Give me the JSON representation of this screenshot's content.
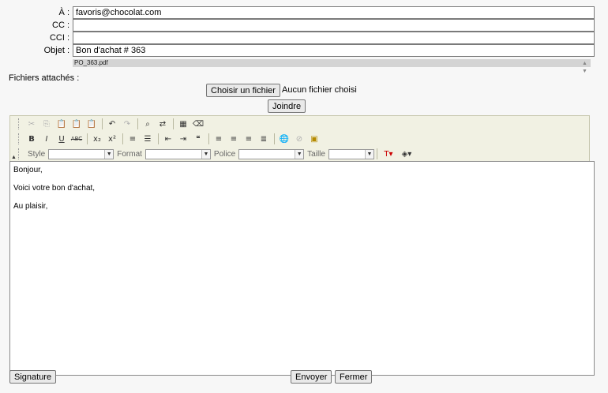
{
  "form": {
    "to_label": "À :",
    "to_value": "favoris@chocolat.com",
    "cc_label": "CC :",
    "cc_value": "",
    "bcc_label": "CCI :",
    "bcc_value": "",
    "subject_label": "Objet :",
    "subject_value": "Bon d'achat # 363",
    "attachments_label": "Fichiers attachés :",
    "attachment_file": "PO_363.pdf",
    "choose_file_label": "Choisir un fichier",
    "no_file_text": "Aucun fichier choisi",
    "attach_button": "Joindre"
  },
  "toolbar": {
    "row1": [
      "cut-icon",
      "copy-icon",
      "paste-icon",
      "paste-text-icon",
      "paste-word-icon",
      "undo-icon",
      "redo-icon",
      "find-icon",
      "replace-icon",
      "table-icon",
      "eraser-icon"
    ],
    "row2": [
      "bold-icon",
      "italic-icon",
      "underline-icon",
      "strikethrough-icon",
      "subscript-icon",
      "superscript-icon",
      "ordered-list-icon",
      "unordered-list-icon",
      "outdent-icon",
      "indent-icon",
      "blockquote-icon",
      "align-left-icon",
      "align-center-icon",
      "align-right-icon",
      "justify-icon",
      "link-icon",
      "unlink-icon",
      "image-icon"
    ],
    "style_label": "Style",
    "format_label": "Format",
    "font_label": "Police",
    "size_label": "Taille",
    "style_value": "",
    "format_value": "",
    "font_value": "",
    "size_value": "",
    "colors": {
      "toolbar_bg": "#f1f1e3"
    }
  },
  "editor": {
    "lines": [
      "Bonjour,",
      "Voici votre bon d'achat,",
      "Au plaisir,"
    ]
  },
  "footer": {
    "signature_button": "Signature",
    "send_button": "Envoyer",
    "close_button": "Fermer"
  }
}
